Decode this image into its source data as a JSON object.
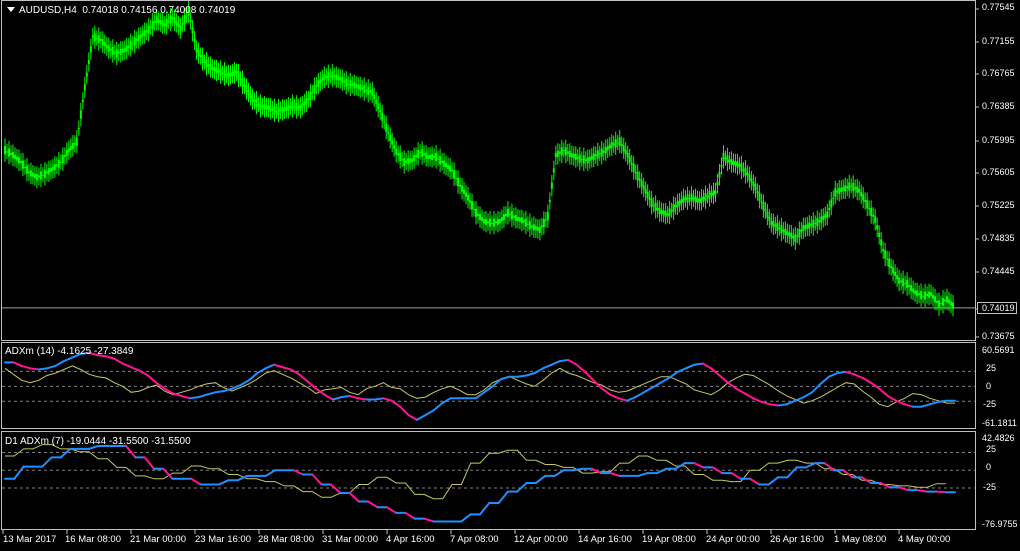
{
  "window": {
    "symbol_header": "AUDUSD,H4  0.74018 0.74156 0.74008 0.74019",
    "current_price": "0.74019"
  },
  "price_axis": {
    "labels": [
      "0.77545",
      "0.77155",
      "0.76765",
      "0.76385",
      "0.75995",
      "0.75605",
      "0.75225",
      "0.74835",
      "0.74445",
      "0.73675"
    ]
  },
  "indicator1": {
    "header": "ADXm (14) -4.1625 -27.3849",
    "labels": [
      "60.5691",
      "25",
      "0",
      "-25",
      "-61.1811"
    ]
  },
  "indicator2": {
    "header": "D1 ADXm (7) -19.0444 -31.5500 -31.5500",
    "labels": [
      "42.4826",
      "25",
      "0",
      "-25",
      "-76.9755"
    ]
  },
  "time_axis": {
    "labels": [
      "13 Mar 2017",
      "16 Mar 08:00",
      "21 Mar 00:00",
      "23 Mar 16:00",
      "28 Mar 08:00",
      "31 Mar 00:00",
      "4 Apr 16:00",
      "7 Apr 08:00",
      "12 Apr 00:00",
      "14 Apr 16:00",
      "19 Apr 08:00",
      "24 Apr 00:00",
      "26 Apr 16:00",
      "1 May 08:00",
      "4 May 00:00"
    ]
  },
  "colors": {
    "background": "#000000",
    "candle": "#00ff00",
    "grid_text": "#ffffff",
    "adx_plus": "#1e90ff",
    "adx_minus": "#ff1493",
    "adx_signal": "#c8c864",
    "separator": "#c0c0c0"
  },
  "chart_data": {
    "type": "line",
    "price_series": {
      "name": "AUDUSD",
      "values": [
        0.7588,
        0.7582,
        0.7574,
        0.7562,
        0.7556,
        0.756,
        0.7566,
        0.7574,
        0.7588,
        0.7598,
        0.7662,
        0.7722,
        0.7718,
        0.7708,
        0.7702,
        0.7706,
        0.7714,
        0.7722,
        0.773,
        0.7742,
        0.7736,
        0.7744,
        0.7732,
        0.7752,
        0.7706,
        0.7692,
        0.7684,
        0.768,
        0.7676,
        0.768,
        0.7664,
        0.7648,
        0.764,
        0.7638,
        0.7634,
        0.7636,
        0.764,
        0.7638,
        0.7648,
        0.7664,
        0.7674,
        0.7676,
        0.7672,
        0.7666,
        0.7664,
        0.766,
        0.7656,
        0.7634,
        0.7608,
        0.7586,
        0.7574,
        0.7576,
        0.7586,
        0.758,
        0.758,
        0.7572,
        0.7564,
        0.7546,
        0.7532,
        0.7514,
        0.7504,
        0.7502,
        0.7504,
        0.7514,
        0.7508,
        0.7504,
        0.7498,
        0.7494,
        0.751,
        0.7582,
        0.7588,
        0.7582,
        0.7578,
        0.7576,
        0.7582,
        0.7586,
        0.7594,
        0.7598,
        0.7582,
        0.7562,
        0.7544,
        0.7526,
        0.7516,
        0.7512,
        0.7522,
        0.753,
        0.7532,
        0.7528,
        0.7534,
        0.7538,
        0.758,
        0.7574,
        0.757,
        0.756,
        0.7544,
        0.7522,
        0.7502,
        0.7496,
        0.749,
        0.7484,
        0.7496,
        0.75,
        0.7504,
        0.7512,
        0.7538,
        0.7542,
        0.7546,
        0.754,
        0.7524,
        0.7506,
        0.747,
        0.745,
        0.7434,
        0.743,
        0.742,
        0.7416,
        0.7418,
        0.7406,
        0.7412,
        0.7402
      ]
    },
    "adx14": {
      "plus": [
        40,
        40,
        34,
        30,
        28,
        30,
        34,
        42,
        48,
        54,
        56,
        52,
        50,
        46,
        38,
        32,
        26,
        18,
        6,
        -4,
        -12,
        -16,
        -20,
        -18,
        -14,
        -10,
        -8,
        -4,
        2,
        10,
        22,
        30,
        36,
        32,
        28,
        20,
        8,
        -4,
        -14,
        -22,
        -18,
        -16,
        -20,
        -22,
        -22,
        -20,
        -24,
        -34,
        -48,
        -56,
        -48,
        -40,
        -28,
        -20,
        -20,
        -20,
        -20,
        -10,
        0,
        12,
        16,
        16,
        18,
        22,
        30,
        36,
        42,
        44,
        36,
        24,
        10,
        -4,
        -14,
        -20,
        -24,
        -18,
        -10,
        -2,
        6,
        14,
        24,
        30,
        36,
        38,
        30,
        18,
        6,
        -4,
        -12,
        -20,
        -26,
        -30,
        -32,
        -30,
        -24,
        -18,
        -10,
        4,
        16,
        22,
        24,
        20,
        14,
        6,
        -4,
        -16,
        -24,
        -30,
        -34,
        -34,
        -30,
        -26,
        -24,
        -24
      ],
      "signal": [
        30,
        20,
        10,
        6,
        10,
        18,
        22,
        28,
        34,
        28,
        20,
        16,
        14,
        6,
        0,
        -10,
        -8,
        -2,
        2,
        -8,
        -14,
        -10,
        -6,
        0,
        4,
        6,
        -2,
        -8,
        -2,
        4,
        12,
        22,
        26,
        20,
        14,
        6,
        -2,
        -12,
        -6,
        -4,
        -2,
        -10,
        -14,
        -4,
        0,
        6,
        -2,
        -4,
        -14,
        -20,
        -18,
        -10,
        -4,
        0,
        -6,
        -14,
        -14,
        -6,
        6,
        12,
        16,
        10,
        4,
        0,
        10,
        22,
        30,
        22,
        18,
        12,
        6,
        2,
        -6,
        -10,
        -8,
        -2,
        4,
        10,
        16,
        16,
        10,
        4,
        -6,
        -10,
        -14,
        -6,
        6,
        14,
        20,
        18,
        10,
        2,
        -8,
        -16,
        -22,
        -28,
        -24,
        -18,
        -10,
        -2,
        6,
        4,
        -8,
        -18,
        -30,
        -34,
        -26,
        -20,
        -12,
        -14,
        -20,
        -24,
        -28,
        -28
      ]
    },
    "adx7_d1": {
      "plus": [
        -12,
        -12,
        5,
        5,
        5,
        18,
        18,
        30,
        30,
        30,
        34,
        34,
        34,
        34,
        18,
        18,
        2,
        2,
        -12,
        -12,
        -12,
        -20,
        -20,
        -20,
        -14,
        -14,
        -8,
        -8,
        -8,
        0,
        0,
        0,
        -6,
        -6,
        -20,
        -20,
        -32,
        -32,
        -44,
        -44,
        -52,
        -52,
        -60,
        -60,
        -68,
        -68,
        -72,
        -72,
        -72,
        -72,
        -62,
        -62,
        -46,
        -46,
        -30,
        -30,
        -18,
        -18,
        -8,
        -8,
        0,
        0,
        2,
        2,
        -4,
        -4,
        -8,
        -8,
        -8,
        -4,
        -4,
        2,
        2,
        10,
        10,
        4,
        4,
        -4,
        -4,
        -12,
        -12,
        -20,
        -20,
        -10,
        -10,
        4,
        4,
        10,
        10,
        0,
        0,
        -10,
        -10,
        -18,
        -18,
        -24,
        -24,
        -28,
        -28,
        -30,
        -30,
        -31,
        -31
      ],
      "signal": [
        20,
        20,
        30,
        30,
        36,
        36,
        30,
        30,
        26,
        26,
        16,
        16,
        4,
        4,
        -8,
        -8,
        -12,
        -12,
        -4,
        -4,
        6,
        6,
        2,
        2,
        -6,
        -6,
        -12,
        -12,
        -16,
        -16,
        -22,
        -22,
        -30,
        -30,
        -38,
        -38,
        -32,
        -32,
        -20,
        -20,
        -10,
        -10,
        -18,
        -18,
        -34,
        -34,
        -40,
        -40,
        -20,
        -20,
        10,
        10,
        24,
        24,
        28,
        28,
        14,
        14,
        8,
        8,
        4,
        4,
        -4,
        -4,
        -2,
        -2,
        10,
        10,
        20,
        20,
        14,
        14,
        6,
        6,
        -6,
        -6,
        -14,
        -14,
        -16,
        -16,
        0,
        0,
        10,
        10,
        14,
        14,
        10,
        10,
        2,
        2,
        -6,
        -6,
        -14,
        -14,
        -20,
        -20,
        -22,
        -22,
        -24,
        -24,
        -19,
        -19
      ]
    }
  }
}
